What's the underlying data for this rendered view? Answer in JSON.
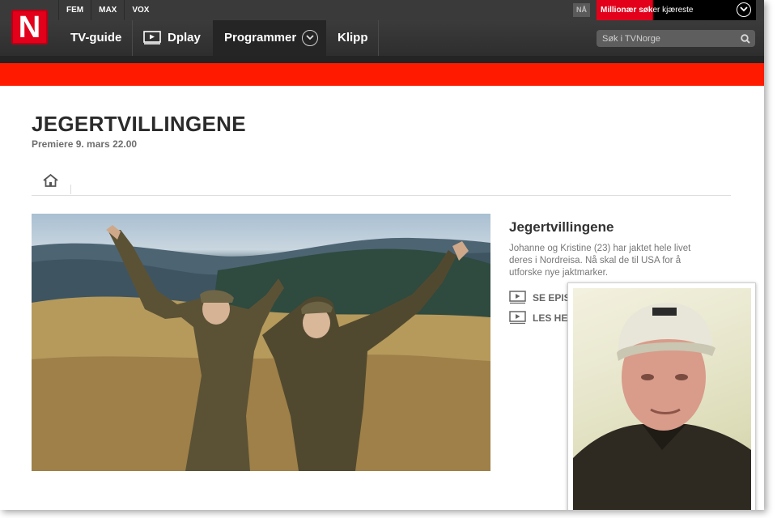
{
  "topbar": {
    "channels": [
      "FEM",
      "MAX",
      "VOX"
    ],
    "now_label": "NÅ",
    "now_show_red": "Millionær søk",
    "now_show_rest": "er kjæreste"
  },
  "logo": {
    "letter": "N"
  },
  "nav": {
    "tv_guide": "TV-guide",
    "dplay": "Dplay",
    "programmer": "Programmer",
    "klipp": "Klipp"
  },
  "search": {
    "placeholder": "Søk i TVNorge"
  },
  "page": {
    "title": "JEGERTVILLINGENE",
    "premiere": "Premiere 9. mars 22.00"
  },
  "sidebar": {
    "title": "Jegertvillingene",
    "description": "Johanne og Kristine (23) har jaktet hele livet deres i Nordreisa. Nå skal de til USA for å utforske nye jaktmarker.",
    "link_episodes": "SE EPIS",
    "link_more": "LES HE"
  },
  "colors": {
    "brand_red": "#e2001a",
    "accent_bar": "#ff1a00",
    "nav_bg": "#333333"
  },
  "icons": {
    "home": "home-icon",
    "play": "play-icon",
    "search": "search-icon",
    "chevron": "chevron-down-icon"
  }
}
